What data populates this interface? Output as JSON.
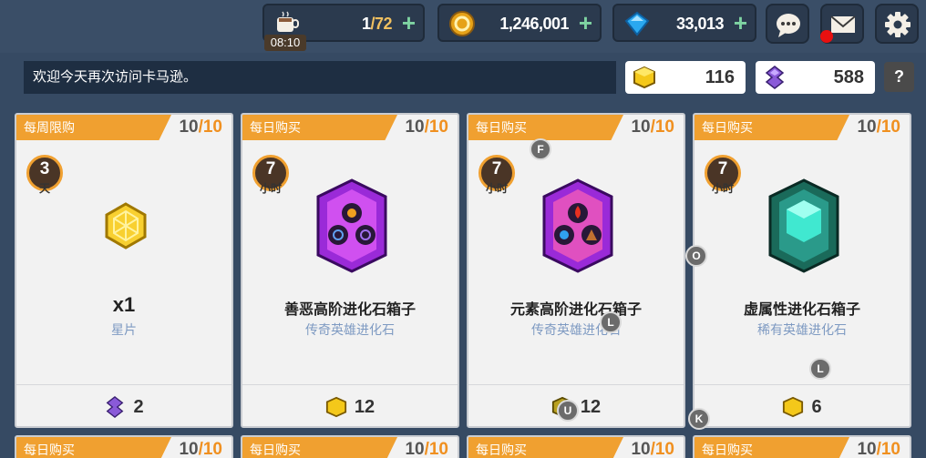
{
  "topbar": {
    "stamina": {
      "current": "1",
      "max": "/72",
      "plus": "+",
      "icon": "coffee-cup-icon"
    },
    "gold": {
      "value": "1,246,001",
      "plus": "+",
      "icon": "gold-coin-icon"
    },
    "gems": {
      "value": "33,013",
      "plus": "+",
      "icon": "blue-gem-icon"
    },
    "timer": "08:10",
    "buttons": [
      "chat-icon",
      "mail-icon",
      "settings-gear-icon"
    ]
  },
  "message": "欢迎今天再次访问卡马逊。",
  "currencies": {
    "yellow_cube": {
      "value": "116",
      "icon": "yellow-cube-icon"
    },
    "purple_crystal": {
      "value": "588",
      "icon": "purple-crystal-icon"
    }
  },
  "help_label": "?",
  "cards": [
    {
      "tag": "每周限购",
      "count": "10",
      "max": "/10",
      "timer_num": "3",
      "timer_unit": "天",
      "name": "x1",
      "sub": "星片",
      "price": "2",
      "price_icon": "purple-crystal-icon",
      "item_icon": "star-shard-icon"
    },
    {
      "tag": "每日购买",
      "count": "10",
      "max": "/10",
      "timer_num": "7",
      "timer_unit": "小时",
      "name": "善恶高阶进化石箱子",
      "sub": "传奇英雄进化石",
      "price": "12",
      "price_icon": "yellow-cube-icon",
      "item_icon": "good-evil-stone-box-icon"
    },
    {
      "tag": "每日购买",
      "count": "10",
      "max": "/10",
      "timer_num": "7",
      "timer_unit": "小时",
      "name": "元素高阶进化石箱子",
      "sub": "传奇英雄进化石",
      "price": "12",
      "price_icon": "yellow-cube-icon",
      "item_icon": "element-stone-box-icon"
    },
    {
      "tag": "每日购买",
      "count": "10",
      "max": "/10",
      "timer_num": "7",
      "timer_unit": "小时",
      "name": "虚属性进化石箱子",
      "sub": "稀有英雄进化石",
      "price": "6",
      "price_icon": "yellow-cube-icon",
      "item_icon": "void-stone-box-icon"
    }
  ],
  "row2_cards": [
    {
      "tag": "每日购买",
      "count": "10",
      "max": "/10"
    },
    {
      "tag": "每日购买",
      "count": "10",
      "max": "/10"
    },
    {
      "tag": "每日购买",
      "count": "10",
      "max": "/10"
    },
    {
      "tag": "每日购买",
      "count": "10",
      "max": "/10"
    }
  ],
  "markers": [
    "F",
    "O",
    "L",
    "K",
    "U",
    "L"
  ]
}
